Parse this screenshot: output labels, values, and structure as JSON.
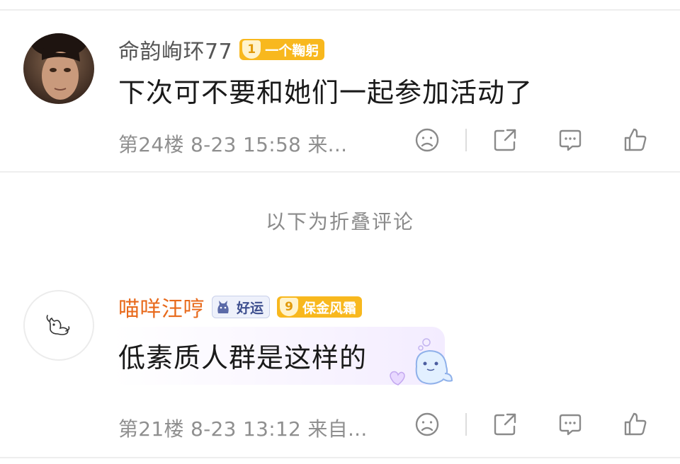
{
  "comments": [
    {
      "username": "命韵峋环77",
      "badge": {
        "level": "1",
        "label": "一个鞠躬"
      },
      "content": "下次可不要和她们一起参加活动了",
      "meta": "第24楼  8-23 15:58  来..."
    },
    {
      "username": "喵咩汪哼",
      "pet_badge": {
        "label": "好运"
      },
      "badge": {
        "level": "9",
        "label": "保金风霜"
      },
      "content": "低素质人群是这样的",
      "meta": "第21楼  8-23 13:12  来自..."
    }
  ],
  "fold_label": "以下为折叠评论",
  "colors": {
    "username_highlight": "#e86a1c",
    "badge_gold": "#f8b81e",
    "meta_gray": "#8f8f8f",
    "icon_gray": "#8a8a8a"
  },
  "icons": {
    "dislike": "sad-face-icon",
    "share": "share-icon",
    "comment": "comment-icon",
    "like": "thumbs-up-icon"
  }
}
